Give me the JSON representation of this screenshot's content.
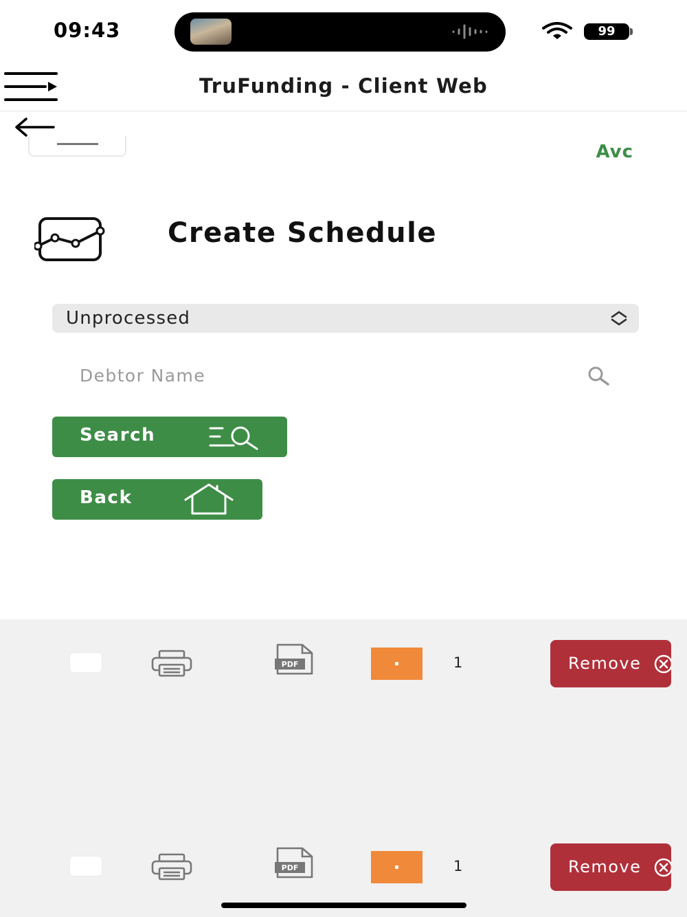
{
  "status_bar": {
    "time": "09:43",
    "battery": "99"
  },
  "header": {
    "title": "TruFunding - Client Web"
  },
  "user": {
    "name": "Avc"
  },
  "page": {
    "title": "Create Schedule"
  },
  "form": {
    "status_select": {
      "value": "Unprocessed"
    },
    "debtor_search": {
      "placeholder": "Debtor Name",
      "value": ""
    },
    "search_button": "Search",
    "back_button": "Back"
  },
  "colors": {
    "accent_green": "#3e8d47",
    "remove_red": "#b0303a",
    "orange": "#f0893a"
  },
  "rows": [
    {
      "count": "1",
      "remove_label": "Remove",
      "pdf_label": "PDF"
    },
    {
      "count": "1",
      "remove_label": "Remove",
      "pdf_label": "PDF"
    }
  ]
}
